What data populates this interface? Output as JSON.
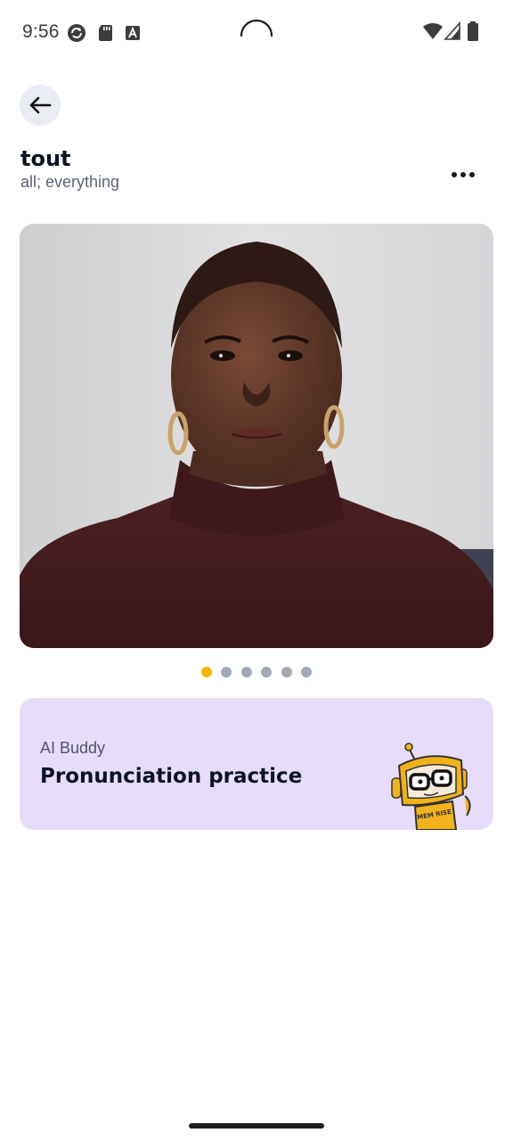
{
  "status_bar": {
    "time": "9:56",
    "icons": [
      "sync-app-icon",
      "sd-card-icon",
      "font-a-icon",
      "loading-spinner",
      "wifi-icon",
      "cell-signal-icon",
      "battery-icon"
    ]
  },
  "header": {
    "back_icon": "arrow-left-icon",
    "word": "tout",
    "translation": "all; everything",
    "more_icon": "more-horizontal-icon"
  },
  "video": {
    "description_icon": "video-thumbnail",
    "total_slides": 6,
    "active_slide": 0
  },
  "ai_card": {
    "label": "AI Buddy",
    "title": "Pronunciation practice",
    "mascot_text": "MEM RISE"
  },
  "colors": {
    "accent_dot": "#f5b800",
    "dot": "#a2a9b6",
    "card_bg": "#e8dcfb",
    "back_bg": "#e9ecf3"
  }
}
